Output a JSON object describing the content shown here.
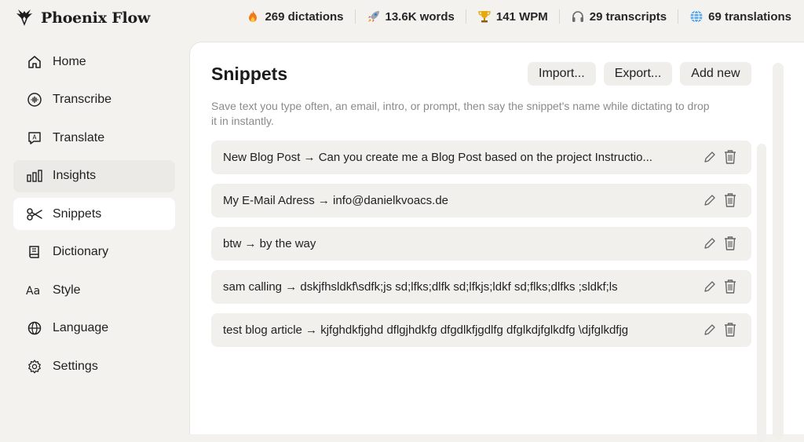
{
  "app": {
    "name": "Phoenix Flow"
  },
  "stats": [
    {
      "icon": "fire-icon",
      "label": "269 dictations"
    },
    {
      "icon": "rocket-icon",
      "label": "13.6K words"
    },
    {
      "icon": "trophy-icon",
      "label": "141 WPM"
    },
    {
      "icon": "headphones-icon",
      "label": "29 transcripts"
    },
    {
      "icon": "globe-icon",
      "label": "69 translations"
    }
  ],
  "sidebar": {
    "items": [
      {
        "icon": "home-icon",
        "label": "Home",
        "state": "default"
      },
      {
        "icon": "waveform-icon",
        "label": "Transcribe",
        "state": "default"
      },
      {
        "icon": "translate-icon",
        "label": "Translate",
        "state": "default"
      },
      {
        "icon": "bar-chart-icon",
        "label": "Insights",
        "state": "hover"
      },
      {
        "icon": "scissors-icon",
        "label": "Snippets",
        "state": "active"
      },
      {
        "icon": "book-icon",
        "label": "Dictionary",
        "state": "default"
      },
      {
        "icon": "text-style-icon",
        "label": "Style",
        "state": "default"
      },
      {
        "icon": "language-globe-icon",
        "label": "Language",
        "state": "default"
      },
      {
        "icon": "gear-icon",
        "label": "Settings",
        "state": "default"
      }
    ]
  },
  "main": {
    "title": "Snippets",
    "actions": {
      "import": "Import...",
      "export": "Export...",
      "add": "Add new"
    },
    "description": "Save text you type often, an email, intro, or prompt, then say the snippet's name while dictating to drop it in instantly.",
    "snippets": [
      {
        "text": "New Blog Post → Can you create me a Blog Post based on the project Instructio..."
      },
      {
        "text": "My E-Mail Adress → info@danielkvoacs.de"
      },
      {
        "text": "btw → by the way"
      },
      {
        "text": "sam calling → dskjfhsldkf\\sdfk;js  sd;lfks;dlfk  sd;lfkjs;ldkf  sd;flks;dlfks  ;sldkf;ls"
      },
      {
        "text": "test blog article → kjfghdkfjghd dflgjhdkfg dfgdlkfjgdlfg  dfglkdjfglkdfg \\djfglkdfjg"
      }
    ]
  }
}
